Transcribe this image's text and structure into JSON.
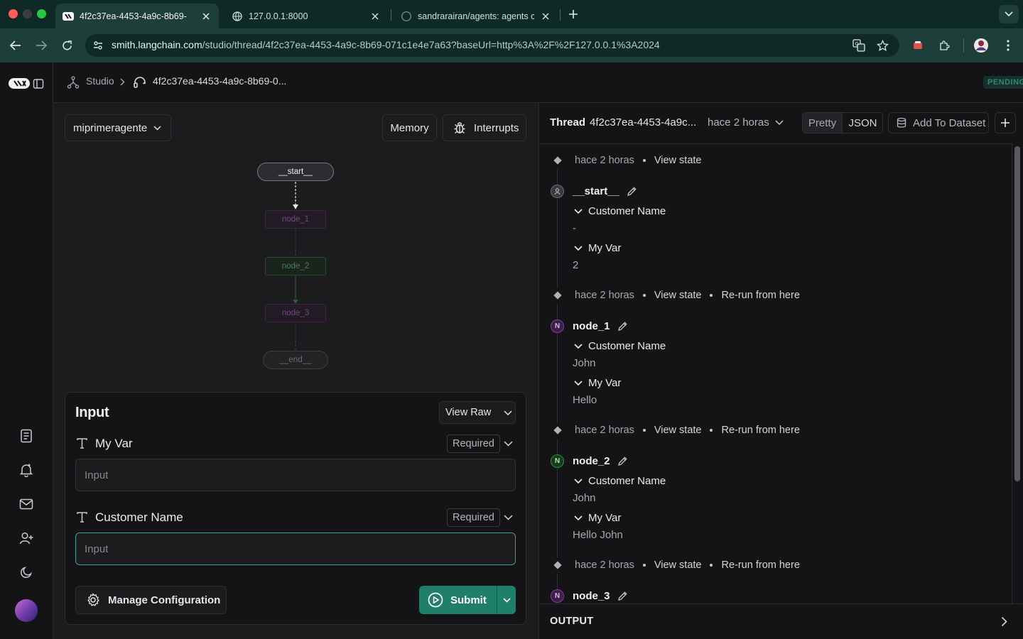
{
  "browser": {
    "tabs": [
      {
        "title": "4f2c37ea-4453-4a9c-8b69-",
        "active": true,
        "icon": "langsmith-favicon"
      },
      {
        "title": "127.0.0.1:8000",
        "active": false,
        "icon": "globe-icon"
      },
      {
        "title": "sandrarairan/agents: agents c",
        "active": false,
        "icon": "github-icon"
      }
    ],
    "url_host": "smith.langchain.com",
    "url_path": "/studio/thread/4f2c37ea-4453-4a9c-8b69-071c1e4e7a63?baseUrl=http%3A%2F%2F127.0.0.1%3A2024"
  },
  "header": {
    "breadcrumb_root": "Studio",
    "breadcrumb_current": "4f2c37ea-4453-4a9c-8b69-0...",
    "status": "PENDING"
  },
  "graph_toolbar": {
    "graph_select": "miprimeragente",
    "memory_label": "Memory",
    "interrupts_label": "Interrupts"
  },
  "graph": {
    "nodes": [
      "__start__",
      "node_1",
      "node_2",
      "node_3",
      "__end__"
    ]
  },
  "input_panel": {
    "title": "Input",
    "view_raw": "View Raw",
    "fields": [
      {
        "label": "My Var",
        "required": "Required",
        "placeholder": "Input"
      },
      {
        "label": "Customer Name",
        "required": "Required",
        "placeholder": "Input"
      }
    ],
    "manage_config": "Manage Configuration",
    "submit": "Submit"
  },
  "thread": {
    "label": "Thread",
    "id": "4f2c37ea-4453-4a9c...",
    "time": "hace 2 horas",
    "view_pretty": "Pretty",
    "view_json": "JSON",
    "add_dataset": "Add To Dataset",
    "view_state": "View state",
    "rerun": "Re-run from here",
    "steps": [
      {
        "name": "__start__",
        "badge": "",
        "customer_name_key": "Customer Name",
        "customer_name": "-",
        "my_var_key": "My Var",
        "my_var": "2"
      },
      {
        "name": "node_1",
        "badge": "N",
        "customer_name_key": "Customer Name",
        "customer_name": "John",
        "my_var_key": "My Var",
        "my_var": "Hello"
      },
      {
        "name": "node_2",
        "badge": "N",
        "customer_name_key": "Customer Name",
        "customer_name": "John",
        "my_var_key": "My Var",
        "my_var": "Hello John"
      },
      {
        "name": "node_3",
        "badge": "N"
      }
    ],
    "output_label": "OUTPUT"
  },
  "colors": {
    "accent": "#1f7f6b",
    "focus_border": "#3aa18a",
    "pending_text": "#2c8a78",
    "node1_badge": "#7b3fa8",
    "node2_badge": "#2f8a3a",
    "node3_badge": "#9a2fa8"
  }
}
